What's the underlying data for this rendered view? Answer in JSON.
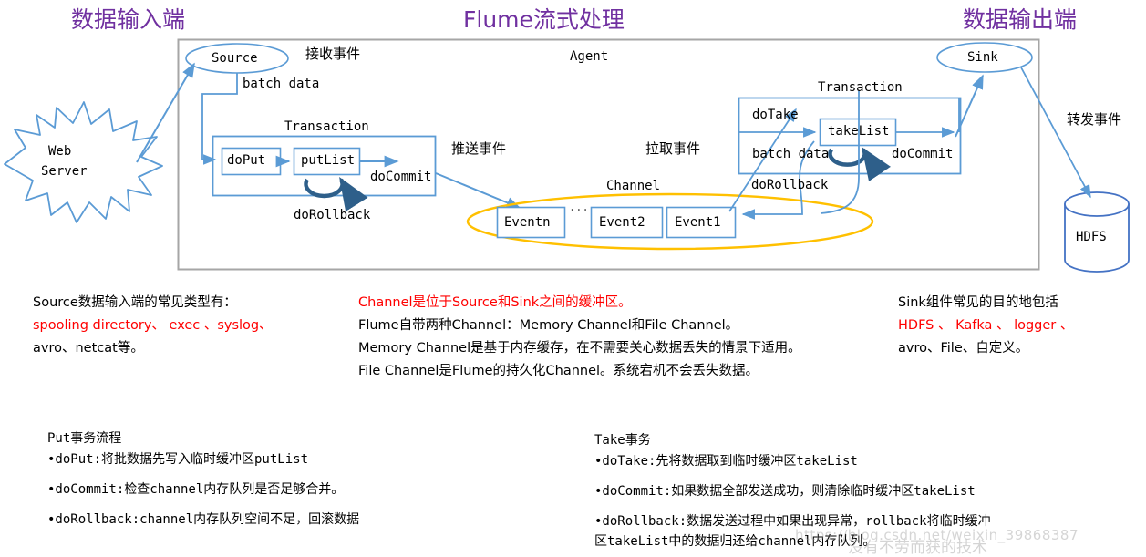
{
  "headers": {
    "input": "数据输入端",
    "main": "Flume流式处理",
    "output": "数据输出端"
  },
  "colors": {
    "header_purple": "#7030A0",
    "shape_blue": "#5B9BD5",
    "channel_orange": "#FFC000",
    "accent_red": "#FF0000",
    "agent_border": "#A6A6A6",
    "arrow_dark_blue": "#2E5F8A"
  },
  "diagram": {
    "agent_label": "Agent",
    "source_label": "Source",
    "sink_label": "Sink",
    "web_server_label_line1": "Web",
    "web_server_label_line2": "Server",
    "hdfs_label": "HDFS",
    "receive_event_label": "接收事件",
    "batch_data_left": "batch data",
    "push_event_label": "推送事件",
    "pull_event_label": "拉取事件",
    "forward_event_label": "转发事件",
    "channel_label": "Channel",
    "ellipsis": "...",
    "events": [
      "Eventn",
      "Event2",
      "Event1"
    ],
    "put_transaction": {
      "title": "Transaction",
      "step1": "doPut",
      "step2": "putList",
      "commit": "doCommit",
      "rollback": "doRollback"
    },
    "take_transaction": {
      "title": "Transaction",
      "take": "doTake",
      "list": "takeList",
      "batch_data": "batch data",
      "commit": "doCommit",
      "rollback": "doRollback"
    }
  },
  "notes": {
    "source": {
      "line1": "Source数据输入端的常见类型有：",
      "line2_red": "spooling directory、 exec 、syslog、",
      "line3": "avro、netcat等。"
    },
    "channel": {
      "line1_red": "Channel是位于Source和Sink之间的缓冲区。",
      "line2": "Flume自带两种Channel：Memory Channel和File Channel。",
      "line3": "Memory Channel是基于内存缓存，在不需要关心数据丢失的情景下适用。",
      "line4": "File Channel是Flume的持久化Channel。系统宕机不会丢失数据。"
    },
    "sink": {
      "line1": "Sink组件常见的目的地包括",
      "line2_red": "HDFS 、 Kafka 、 logger 、",
      "line3": "avro、File、自定义。"
    }
  },
  "flows": {
    "put": {
      "title": "Put事务流程",
      "items": [
        "•doPut:将批数据先写入临时缓冲区putList",
        "•doCommit:检查channel内存队列是否足够合并。",
        "•doRollback:channel内存队列空间不足，回滚数据"
      ]
    },
    "take": {
      "title": "Take事务",
      "items": [
        "•doTake:先将数据取到临时缓冲区takeList",
        "•doCommit:如果数据全部发送成功，则清除临时缓冲区takeList",
        "•doRollback:数据发送过程中如果出现异常，rollback将临时缓冲",
        "区takeList中的数据归还给channel内存队列。"
      ]
    }
  },
  "watermark": {
    "url": "https://blog.csdn.net/weixin_39868387",
    "text": "没有不劳而获的技术"
  }
}
